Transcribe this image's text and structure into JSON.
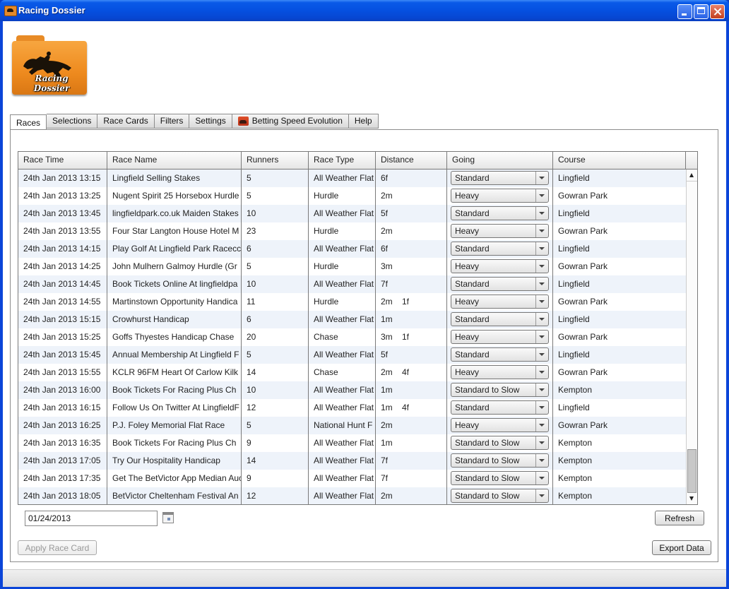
{
  "window": {
    "title": "Racing Dossier",
    "logo_text": "Racing Dossier"
  },
  "tabs": [
    {
      "label": "Races",
      "active": true
    },
    {
      "label": "Selections"
    },
    {
      "label": "Race Cards"
    },
    {
      "label": "Filters"
    },
    {
      "label": "Settings"
    },
    {
      "label": "Betting Speed Evolution",
      "icon": "horse-icon"
    },
    {
      "label": "Help"
    }
  ],
  "table": {
    "columns": [
      "Race Time",
      "Race Name",
      "Runners",
      "Race Type",
      "Distance",
      "Going",
      "Course"
    ],
    "rows": [
      {
        "time": "24th Jan 2013 13:15",
        "name": "Lingfield Selling Stakes",
        "runners": "5",
        "type": "All Weather Flat",
        "distance": "6f",
        "going": "Standard",
        "course": "Lingfield"
      },
      {
        "time": "24th Jan 2013 13:25",
        "name": "Nugent Spirit 25 Horsebox Hurdle",
        "runners": "5",
        "type": "Hurdle",
        "distance": "2m",
        "going": "Heavy",
        "course": "Gowran Park"
      },
      {
        "time": "24th Jan 2013 13:45",
        "name": "lingfieldpark.co.uk Maiden Stakes",
        "runners": "10",
        "type": "All Weather Flat",
        "distance": "5f",
        "going": "Standard",
        "course": "Lingfield"
      },
      {
        "time": "24th Jan 2013 13:55",
        "name": "Four Star Langton House Hotel M",
        "runners": "23",
        "type": "Hurdle",
        "distance": "2m",
        "going": "Heavy",
        "course": "Gowran Park"
      },
      {
        "time": "24th Jan 2013 14:15",
        "name": "Play Golf At Lingfield Park Racecc",
        "runners": "6",
        "type": "All Weather Flat",
        "distance": "6f",
        "going": "Standard",
        "course": "Lingfield"
      },
      {
        "time": "24th Jan 2013 14:25",
        "name": "John Mulhern Galmoy Hurdle (Gr",
        "runners": "5",
        "type": "Hurdle",
        "distance": "3m",
        "going": "Heavy",
        "course": "Gowran Park"
      },
      {
        "time": "24th Jan 2013 14:45",
        "name": "Book Tickets Online At lingfieldpa",
        "runners": "10",
        "type": "All Weather Flat",
        "distance": "7f",
        "going": "Standard",
        "course": "Lingfield"
      },
      {
        "time": "24th Jan 2013 14:55",
        "name": "Martinstown Opportunity Handica",
        "runners": "11",
        "type": "Hurdle",
        "distance": "2m    1f",
        "going": "Heavy",
        "course": "Gowran Park"
      },
      {
        "time": "24th Jan 2013 15:15",
        "name": "Crowhurst Handicap",
        "runners": "6",
        "type": "All Weather Flat",
        "distance": "1m",
        "going": "Standard",
        "course": "Lingfield"
      },
      {
        "time": "24th Jan 2013 15:25",
        "name": "Goffs Thyestes Handicap Chase",
        "runners": "20",
        "type": "Chase",
        "distance": "3m    1f",
        "going": "Heavy",
        "course": "Gowran Park"
      },
      {
        "time": "24th Jan 2013 15:45",
        "name": "Annual Membership At Lingfield F",
        "runners": "5",
        "type": "All Weather Flat",
        "distance": "5f",
        "going": "Standard",
        "course": "Lingfield"
      },
      {
        "time": "24th Jan 2013 15:55",
        "name": "KCLR 96FM Heart Of Carlow Kilk",
        "runners": "14",
        "type": "Chase",
        "distance": "2m    4f",
        "going": "Heavy",
        "course": "Gowran Park"
      },
      {
        "time": "24th Jan 2013 16:00",
        "name": "Book Tickets For Racing Plus Ch",
        "runners": "10",
        "type": "All Weather Flat",
        "distance": "1m",
        "going": "Standard to Slow",
        "course": "Kempton"
      },
      {
        "time": "24th Jan 2013 16:15",
        "name": "Follow Us On Twitter At LingfieldF",
        "runners": "12",
        "type": "All Weather Flat",
        "distance": "1m    4f",
        "going": "Standard",
        "course": "Lingfield"
      },
      {
        "time": "24th Jan 2013 16:25",
        "name": "P.J. Foley Memorial Flat Race",
        "runners": "5",
        "type": "National Hunt F",
        "distance": "2m",
        "going": "Heavy",
        "course": "Gowran Park"
      },
      {
        "time": "24th Jan 2013 16:35",
        "name": "Book Tickets For Racing Plus Ch",
        "runners": "9",
        "type": "All Weather Flat",
        "distance": "1m",
        "going": "Standard to Slow",
        "course": "Kempton"
      },
      {
        "time": "24th Jan 2013 17:05",
        "name": "Try Our Hospitality Handicap",
        "runners": "14",
        "type": "All Weather Flat",
        "distance": "7f",
        "going": "Standard to Slow",
        "course": "Kempton"
      },
      {
        "time": "24th Jan 2013 17:35",
        "name": "Get The BetVictor App Median Auc",
        "runners": "9",
        "type": "All Weather Flat",
        "distance": "7f",
        "going": "Standard to Slow",
        "course": "Kempton"
      },
      {
        "time": "24th Jan 2013 18:05",
        "name": "BetVictor Cheltenham Festival An",
        "runners": "12",
        "type": "All Weather Flat",
        "distance": "2m",
        "going": "Standard to Slow",
        "course": "Kempton"
      }
    ]
  },
  "date_field": {
    "value": "01/24/2013"
  },
  "buttons": {
    "refresh": "Refresh",
    "apply_race_card": "Apply Race Card",
    "export_data": "Export Data"
  }
}
